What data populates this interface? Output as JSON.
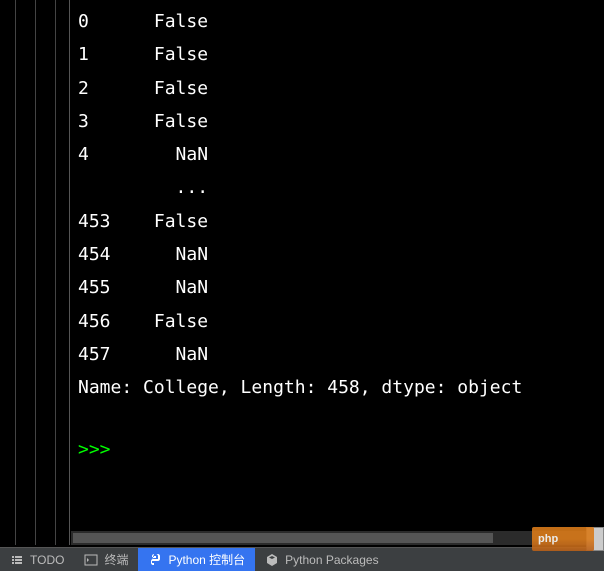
{
  "console": {
    "rows": [
      {
        "index": "0",
        "value": "False"
      },
      {
        "index": "1",
        "value": "False"
      },
      {
        "index": "2",
        "value": "False"
      },
      {
        "index": "3",
        "value": "False"
      },
      {
        "index": "4",
        "value": "  NaN"
      },
      {
        "index": " ",
        "value": "  ..."
      },
      {
        "index": "453",
        "value": "False"
      },
      {
        "index": "454",
        "value": "  NaN"
      },
      {
        "index": "455",
        "value": "  NaN"
      },
      {
        "index": "456",
        "value": "False"
      },
      {
        "index": "457",
        "value": "  NaN"
      }
    ],
    "summary": "Name: College, Length: 458, dtype: object",
    "prompt": ">>> "
  },
  "tabs": {
    "todo": "TODO",
    "terminal": "终端",
    "python_console": "Python 控制台",
    "python_packages": "Python Packages"
  },
  "watermark": "php"
}
